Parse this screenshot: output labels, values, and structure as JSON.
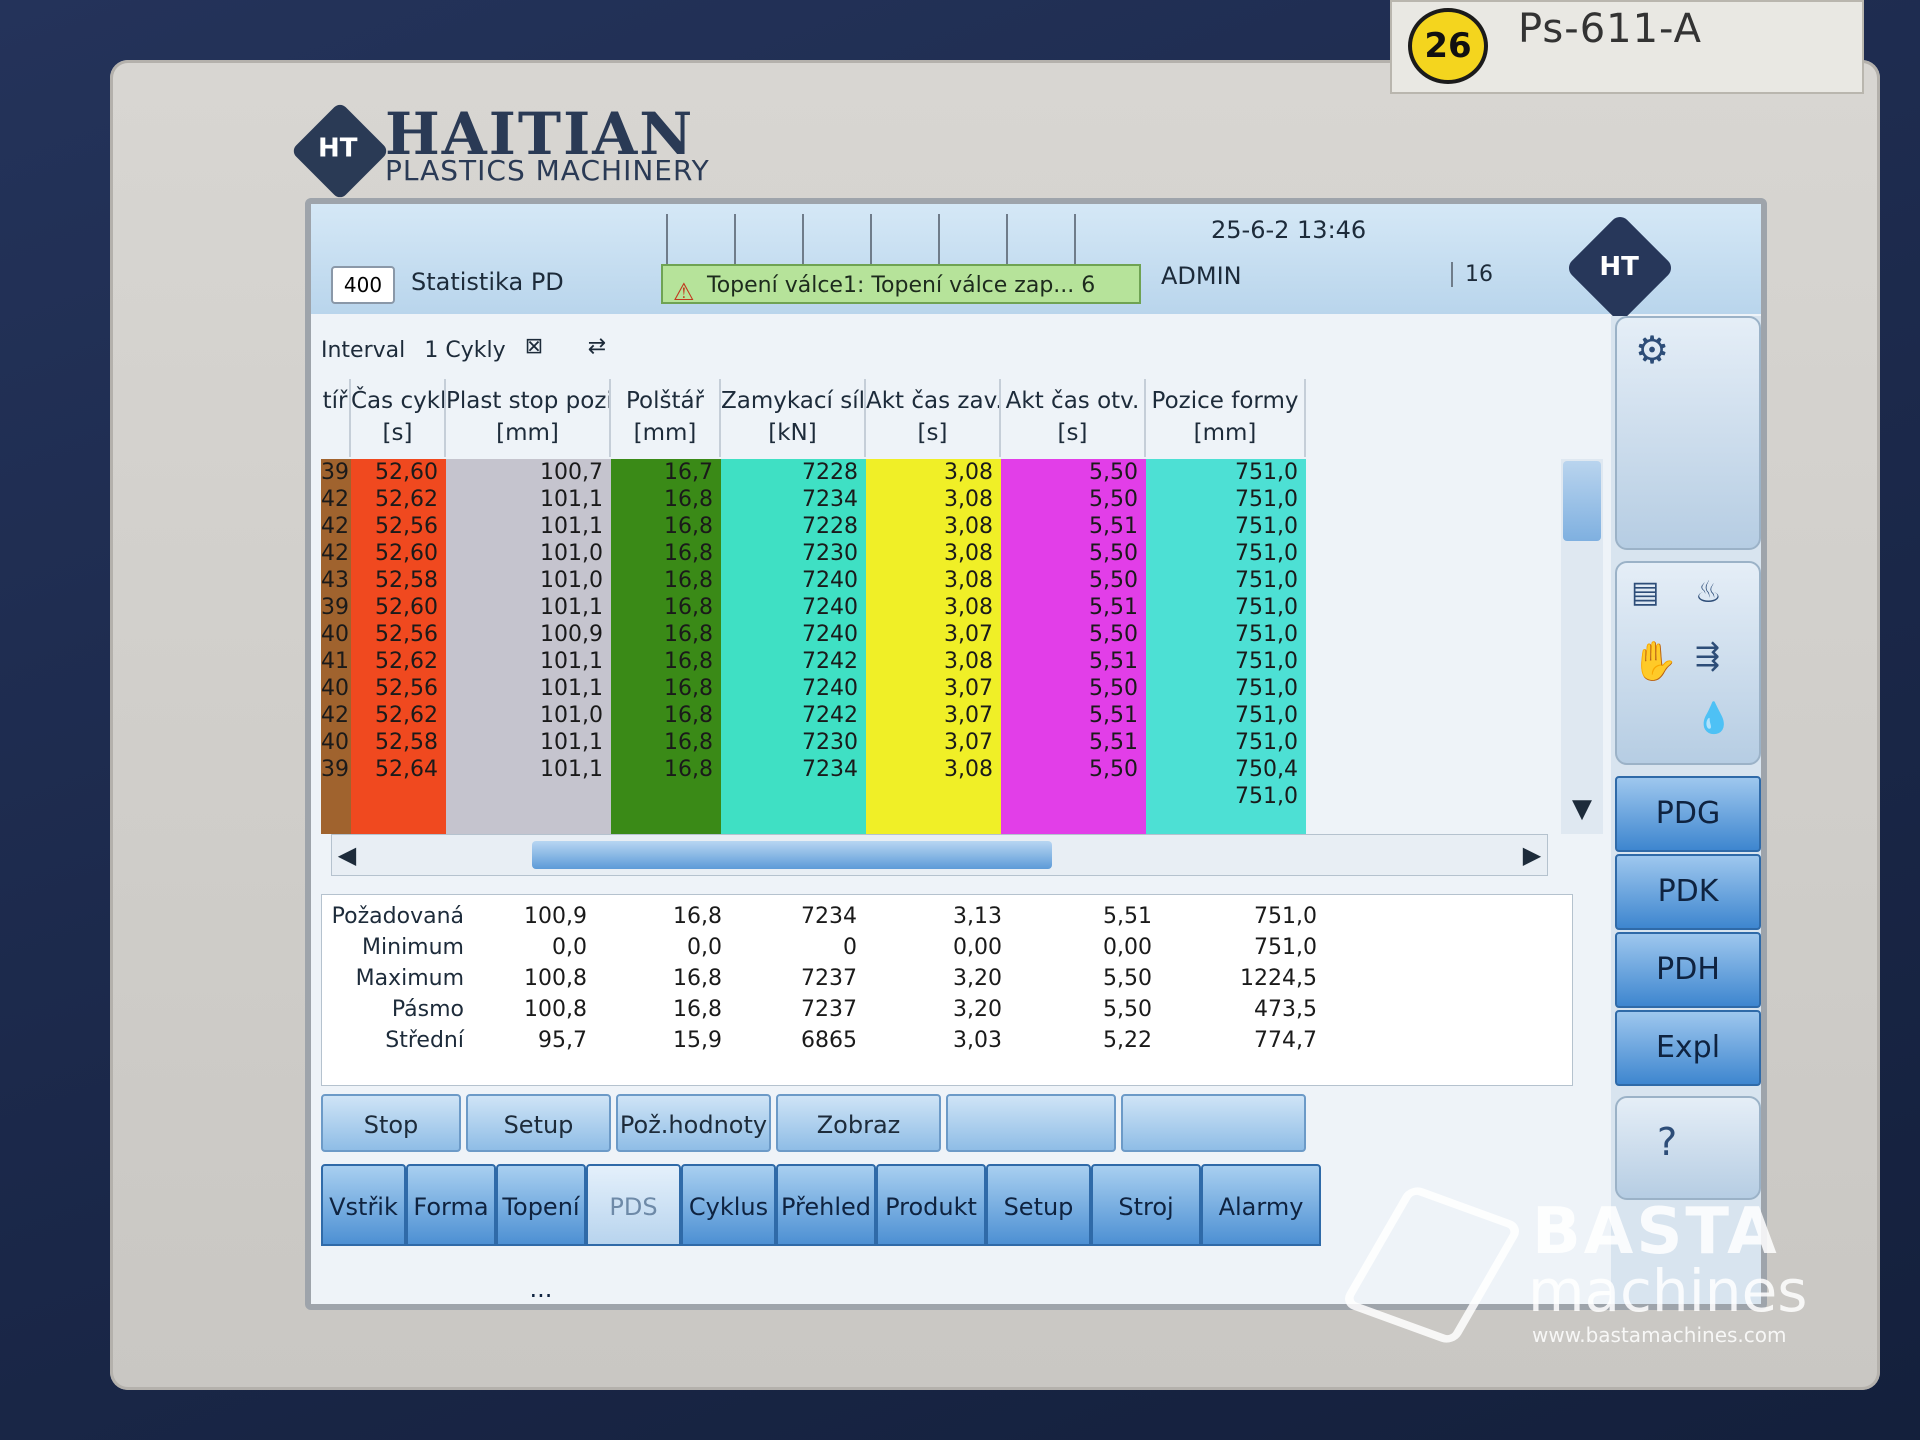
{
  "machine": {
    "brand_name": "HAITIAN",
    "brand_sub": "PLASTICS MACHINERY",
    "brand_logo": "HT",
    "sticker_number": "26",
    "id_plate": "Ps-611-A"
  },
  "header": {
    "screen_number": "400",
    "screen_title": "Statistika PD",
    "alarm_text": "Topení válce1: Topení  válce zap... 6",
    "datetime": "25-6-2 13:46",
    "user": "ADMIN",
    "user_number": "16",
    "logo": "HT"
  },
  "toolbar": {
    "interval_label": "Interval",
    "cycles_label": "1 Cykly"
  },
  "table": {
    "columns": [
      {
        "label1": "tíř",
        "label2": "",
        "color": "#a0632e",
        "text": "#1a1a1a"
      },
      {
        "label1": "Čas cyklu",
        "label2": "[s]",
        "color": "#f0491f",
        "text": "#1a1a1a"
      },
      {
        "label1": "Plast stop pozice",
        "label2": "[mm]",
        "color": "#c5c4ce",
        "text": "#1a1a1a"
      },
      {
        "label1": "Polštář",
        "label2": "[mm]",
        "color": "#3a8a17",
        "text": "#1a1a1a"
      },
      {
        "label1": "Zamykací síla",
        "label2": "[kN]",
        "color": "#3fe0c4",
        "text": "#1a1a1a"
      },
      {
        "label1": "Akt čas zav.",
        "label2": "[s]",
        "color": "#f0ef27",
        "text": "#1a1a1a"
      },
      {
        "label1": "Akt čas otv.",
        "label2": "[s]",
        "color": "#e23ee8",
        "text": "#1a1a1a"
      },
      {
        "label1": "Pozice formy",
        "label2": "[mm]",
        "color": "#4de0d4",
        "text": "#1a1a1a"
      }
    ],
    "rows": [
      [
        "39",
        "52,60",
        "100,7",
        "16,7",
        "7228",
        "3,08",
        "5,50",
        "751,0"
      ],
      [
        "42",
        "52,62",
        "101,1",
        "16,8",
        "7234",
        "3,08",
        "5,50",
        "751,0"
      ],
      [
        "42",
        "52,56",
        "101,1",
        "16,8",
        "7228",
        "3,08",
        "5,51",
        "751,0"
      ],
      [
        "42",
        "52,60",
        "101,0",
        "16,8",
        "7230",
        "3,08",
        "5,50",
        "751,0"
      ],
      [
        "43",
        "52,58",
        "101,0",
        "16,8",
        "7240",
        "3,08",
        "5,50",
        "751,0"
      ],
      [
        "39",
        "52,60",
        "101,1",
        "16,8",
        "7240",
        "3,08",
        "5,51",
        "751,0"
      ],
      [
        "40",
        "52,56",
        "100,9",
        "16,8",
        "7240",
        "3,07",
        "5,50",
        "751,0"
      ],
      [
        "41",
        "52,62",
        "101,1",
        "16,8",
        "7242",
        "3,08",
        "5,51",
        "751,0"
      ],
      [
        "40",
        "52,56",
        "101,1",
        "16,8",
        "7240",
        "3,07",
        "5,50",
        "751,0"
      ],
      [
        "42",
        "52,62",
        "101,0",
        "16,8",
        "7242",
        "3,07",
        "5,51",
        "751,0"
      ],
      [
        "40",
        "52,58",
        "101,1",
        "16,8",
        "7230",
        "3,07",
        "5,51",
        "751,0"
      ],
      [
        "39",
        "52,64",
        "101,1",
        "16,8",
        "7234",
        "3,08",
        "5,50",
        "750,4"
      ],
      [
        "",
        "",
        "",
        "",
        "",
        "",
        "",
        "751,0"
      ]
    ]
  },
  "stats": {
    "labels": [
      "Požadovaná",
      "Minimum",
      "Maximum",
      "Pásmo",
      "Střední"
    ],
    "columns": [
      [
        "100,9",
        "0,0",
        "100,8",
        "100,8",
        "95,7"
      ],
      [
        "16,8",
        "0,0",
        "16,8",
        "16,8",
        "15,9"
      ],
      [
        "7234",
        "0",
        "7237",
        "7237",
        "6865"
      ],
      [
        "3,13",
        "0,00",
        "3,20",
        "3,20",
        "3,03"
      ],
      [
        "5,51",
        "0,00",
        "5,50",
        "5,50",
        "5,22"
      ],
      [
        "751,0",
        "751,0",
        "1224,5",
        "473,5",
        "774,7"
      ]
    ]
  },
  "function_buttons": [
    "Stop",
    "Setup",
    "Pož.hodnoty",
    "Zobraz",
    "",
    ""
  ],
  "tabs": [
    {
      "label": "Vstřik",
      "active": false
    },
    {
      "label": "Forma",
      "active": false
    },
    {
      "label": "Topení ...",
      "active": false
    },
    {
      "label": "PDS",
      "active": true
    },
    {
      "label": "Cyklus",
      "active": false
    },
    {
      "label": "Přehled",
      "active": false
    },
    {
      "label": "Produkt",
      "active": false
    },
    {
      "label": "Setup",
      "active": false
    },
    {
      "label": "Stroj",
      "active": false
    },
    {
      "label": "Alarmy",
      "active": false
    }
  ],
  "side_buttons": [
    "PDG",
    "PDK",
    "PDH",
    "Expl"
  ],
  "watermark": {
    "title": "BASTA",
    "sub": "machines",
    "url": "www.bastamachines.com"
  }
}
